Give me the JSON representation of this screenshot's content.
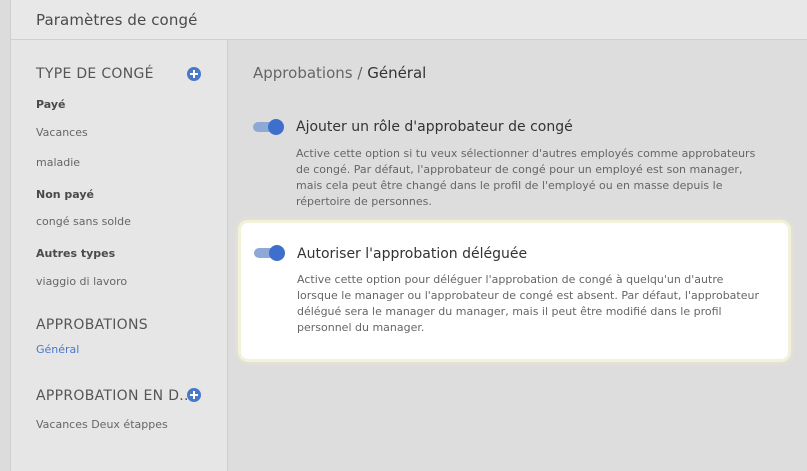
{
  "header": {
    "title": "Paramètres de congé"
  },
  "sidebar": {
    "leave_types_heading": "TYPE DE CONGÉ",
    "paid_heading": "Payé",
    "paid_items": [
      "Vacances",
      "maladie"
    ],
    "unpaid_heading": "Non payé",
    "unpaid_items": [
      "congé sans solde"
    ],
    "other_heading": "Autres types",
    "other_items": [
      "viaggio di lavoro"
    ],
    "approvals_heading": "APPROBATIONS",
    "approvals_items": [
      "Général"
    ],
    "approval_flow_heading": "APPROBATION EN D...",
    "approval_flow_items": [
      "Vacances Deux étappes"
    ]
  },
  "main": {
    "breadcrumb_parent": "Approbations",
    "breadcrumb_separator": "/",
    "breadcrumb_current": "Général",
    "options": [
      {
        "title": "Ajouter un rôle d'approbateur de congé",
        "enabled": true,
        "description": "Active cette option si tu veux sélectionner d'autres employés comme approbateurs de congé. Par défaut, l'approbateur de congé pour un employé est son manager, mais cela peut être changé dans le profil de l'employé ou en masse depuis le répertoire de personnes."
      },
      {
        "title": "Autoriser l'approbation déléguée",
        "enabled": true,
        "description": "Active cette option pour déléguer l'approbation de congé à quelqu'un d'autre lorsque le manager ou l'approbateur de congé est absent. Par défaut, l'approbateur délégué sera le manager du manager, mais il peut être modifié dans le profil personnel du manager."
      }
    ]
  },
  "colors": {
    "accent": "#4a78c9",
    "toggle_knob": "#3f6fcd",
    "toggle_track": "#8fa9d6",
    "highlight_border": "#f2f1d9"
  }
}
